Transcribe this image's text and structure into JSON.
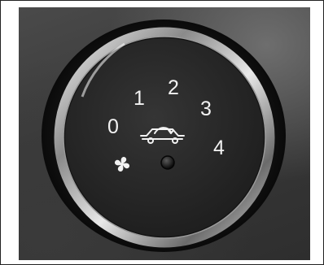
{
  "knob": {
    "positions": [
      "0",
      "1",
      "2",
      "3",
      "4"
    ]
  },
  "icons": {
    "fan": "fan-icon",
    "recirculation": "car-recirculation-icon",
    "indicator": "indicator-light-icon"
  },
  "colors": {
    "panel": "#3b3b3b",
    "knob_face": "#2a2a2a",
    "chrome_ring": "#d9d9d9",
    "label": "#f2f2f2"
  }
}
